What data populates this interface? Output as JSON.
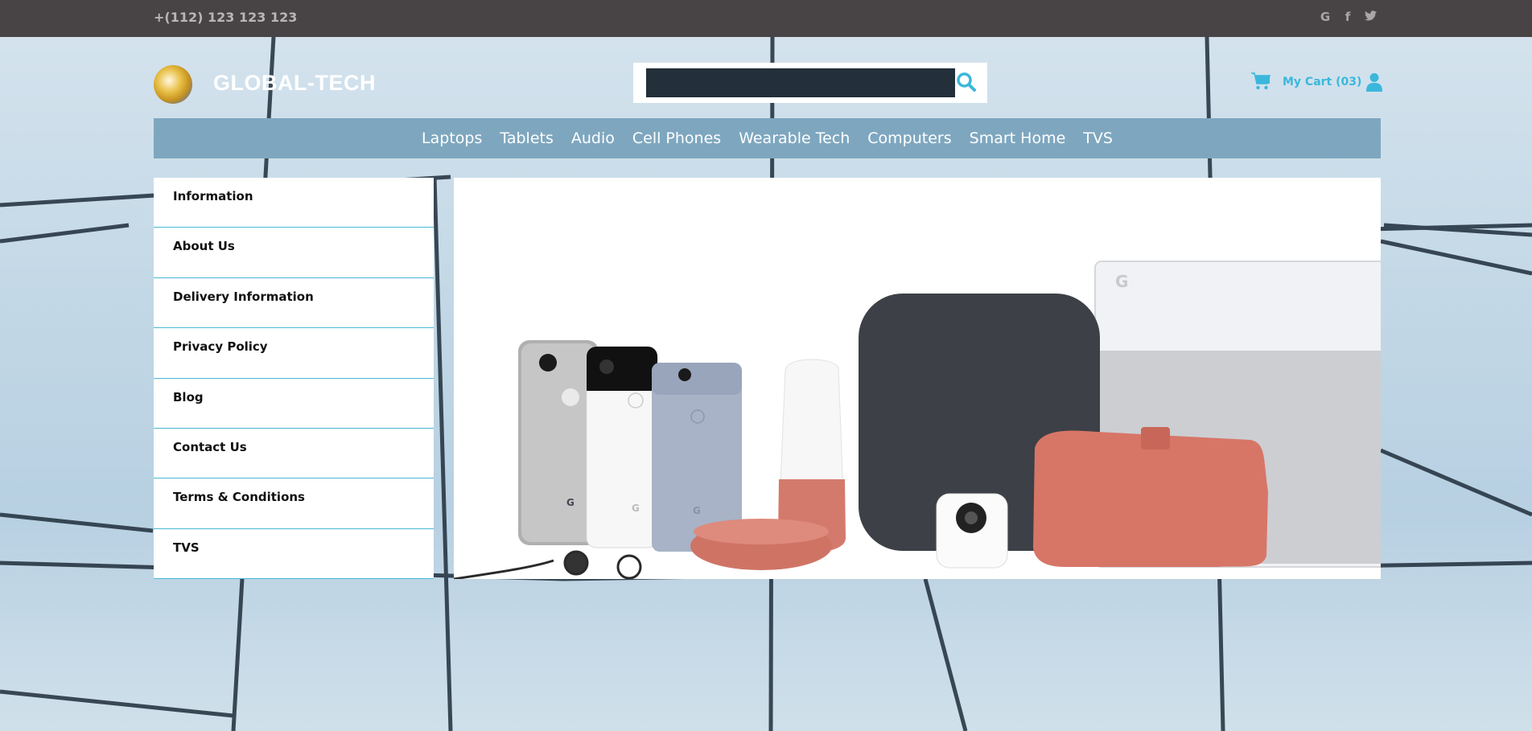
{
  "topbar": {
    "phone": "+(112) 123 123 123",
    "social": [
      {
        "icon": "google-icon",
        "glyph": "G"
      },
      {
        "icon": "facebook-icon",
        "glyph": "f"
      },
      {
        "icon": "twitter-icon",
        "glyph": "❧"
      }
    ]
  },
  "header": {
    "brand": "GLOBAL-TECH",
    "search": {
      "value": "",
      "placeholder": ""
    },
    "cart_label": "My Cart (03)"
  },
  "nav": {
    "items": [
      "Laptops",
      "Tablets",
      "Audio",
      "Cell Phones",
      "Wearable Tech",
      "Computers",
      "Smart Home",
      "TVS"
    ]
  },
  "sidebar": {
    "items": [
      "Information",
      "About Us",
      "Delivery Information",
      "Privacy Policy",
      "Blog",
      "Contact Us",
      "Terms & Conditions",
      "TVS"
    ]
  },
  "banner": {
    "image": "google-devices-product-lineup",
    "colors": {
      "coral": "#d9766a",
      "charcoal": "#3d4046",
      "phone_blue": "#9aa9c2"
    }
  },
  "colors": {
    "topbar": "#484344",
    "accent": "#3bb7dc",
    "nav": "#7ea7bf",
    "sidebar_border": "#47b9d3"
  }
}
